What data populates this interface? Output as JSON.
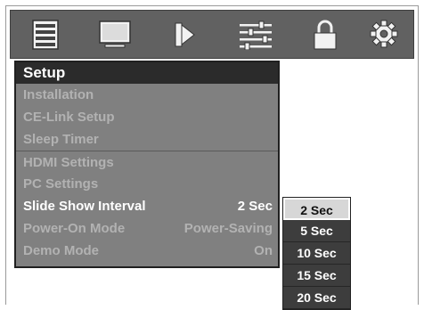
{
  "icons": [
    "setup-menu-icon",
    "picture-icon",
    "sound-icon",
    "adjust-icon",
    "lock-icon",
    "settings-gear-icon"
  ],
  "setup_menu": {
    "title": "Setup",
    "items": [
      {
        "label": "Installation",
        "value": ""
      },
      {
        "label": "CE-Link Setup",
        "value": ""
      },
      {
        "label": "Sleep Timer",
        "value": ""
      },
      {
        "label": "HDMI Settings",
        "value": ""
      },
      {
        "label": "PC Settings",
        "value": ""
      },
      {
        "label": "Slide Show Interval",
        "value": "2 Sec"
      },
      {
        "label": "Power-On Mode",
        "value": "Power-Saving"
      },
      {
        "label": "Demo Mode",
        "value": "On"
      }
    ]
  },
  "interval_options": [
    "2 Sec",
    "5 Sec",
    "10 Sec",
    "15 Sec",
    "20 Sec"
  ],
  "selected_interval": "2 Sec",
  "colors": {
    "menu_bar": "#616161",
    "panel": "#808080",
    "title_bar": "#2b2b2b",
    "selected_option": "#d7d7d7"
  }
}
